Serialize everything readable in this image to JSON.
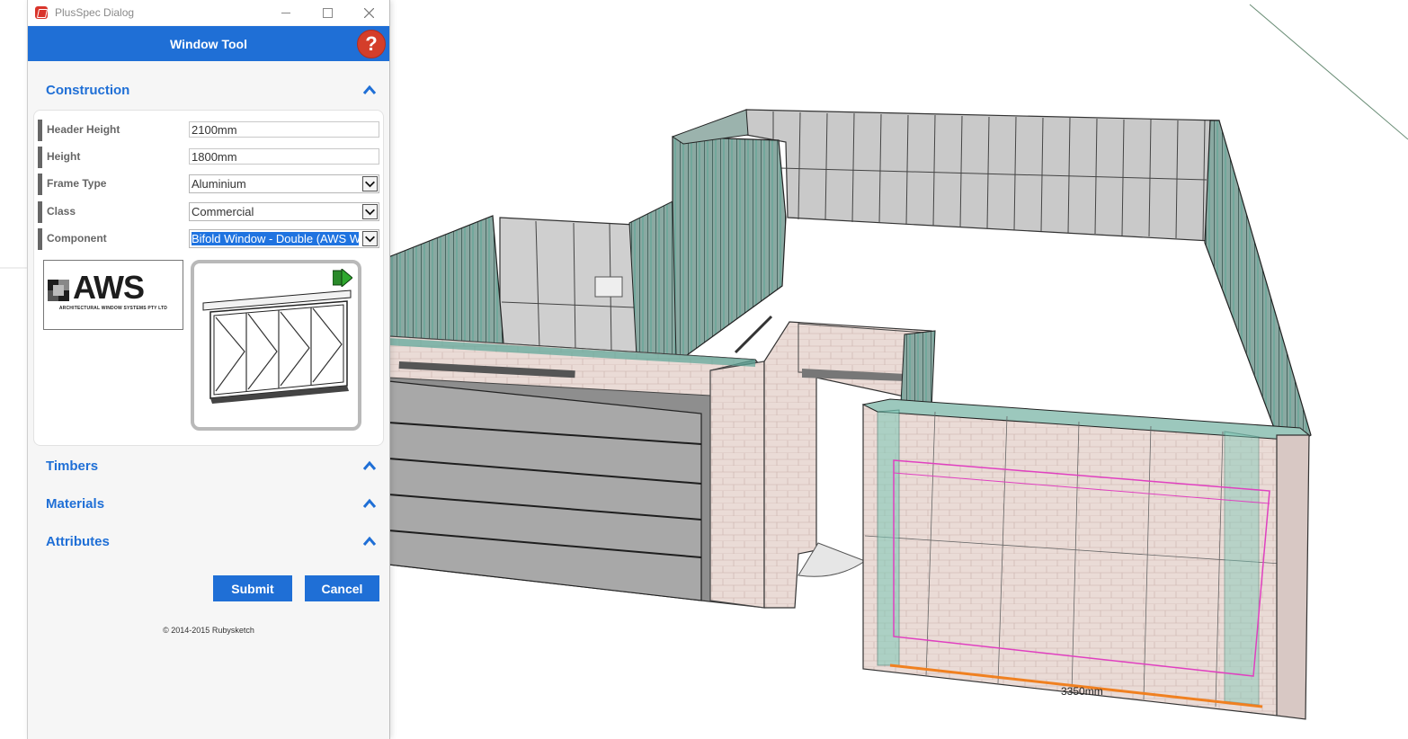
{
  "dialog": {
    "window_title": "PlusSpec Dialog",
    "header_title": "Window Tool",
    "help_label": "?",
    "sections": {
      "construction": "Construction",
      "timbers": "Timbers",
      "materials": "Materials",
      "attributes": "Attributes"
    },
    "fields": {
      "header_height": {
        "label": "Header Height",
        "value": "2100mm"
      },
      "height": {
        "label": "Height",
        "value": "1800mm"
      },
      "frame_type": {
        "label": "Frame Type",
        "value": "Aluminium"
      },
      "class": {
        "label": "Class",
        "value": "Commercial"
      },
      "component": {
        "label": "Component",
        "value": "Bifold Window - Double (AWS W"
      }
    },
    "logo": {
      "text": "AWS",
      "subtitle": "ARCHITECTURAL WINDOW SYSTEMS PTY LTD"
    },
    "buttons": {
      "submit": "Submit",
      "cancel": "Cancel"
    },
    "copyright": "© 2014-2015 Rubysketch"
  },
  "viewport": {
    "dimension_label": "3350mm"
  },
  "colors": {
    "accent": "#1f6fd6",
    "help": "#d43e2a",
    "glass": "#5fb8a8",
    "brick": "#e6d4cf",
    "highlight": "#e040c0",
    "dimension": "#f08020"
  }
}
